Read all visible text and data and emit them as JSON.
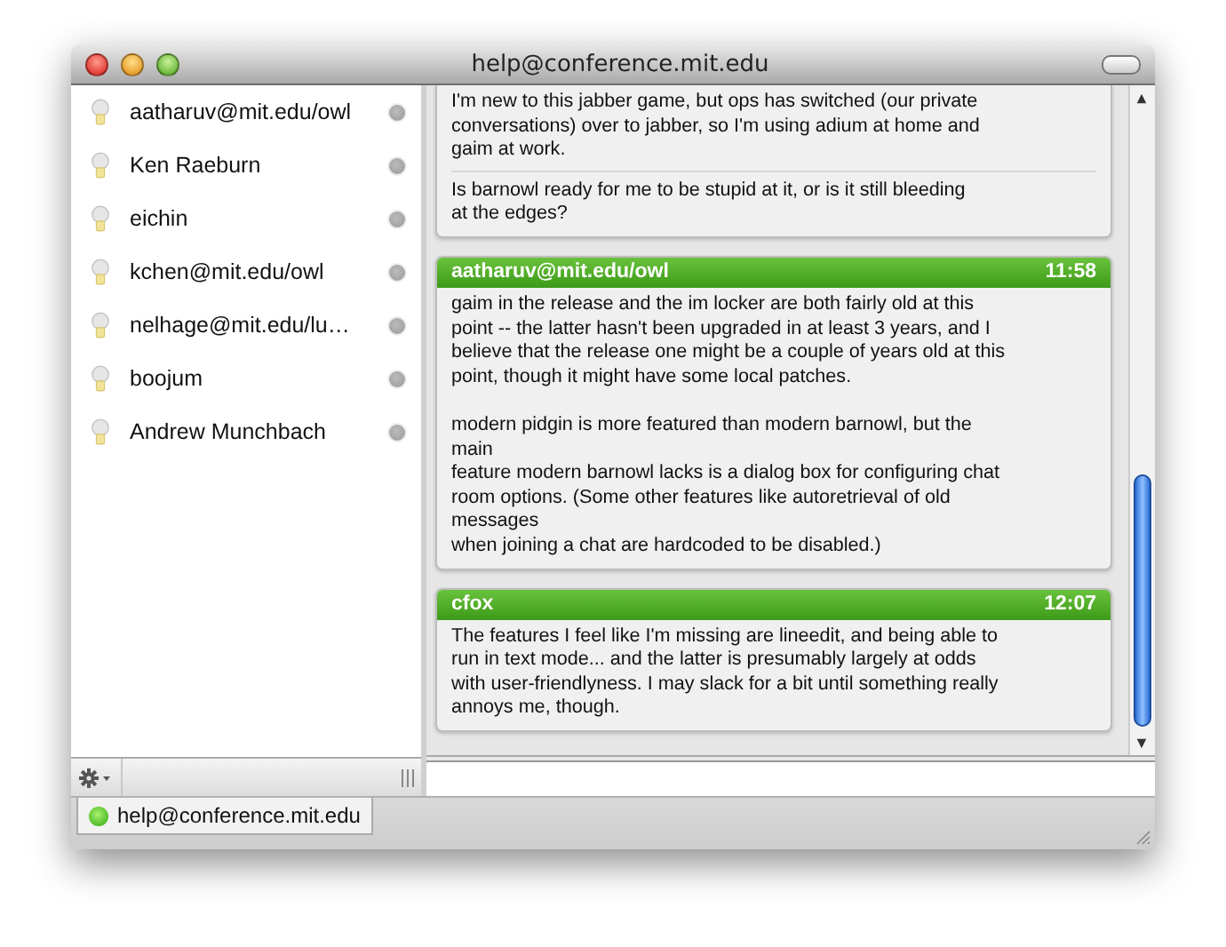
{
  "window": {
    "title": "help@conference.mit.edu"
  },
  "contacts": [
    {
      "name": "aatharuv@mit.edu/owl"
    },
    {
      "name": "Ken Raeburn"
    },
    {
      "name": "eichin"
    },
    {
      "name": "kchen@mit.edu/owl"
    },
    {
      "name": "nelhage@mit.edu/lu…"
    },
    {
      "name": "boojum"
    },
    {
      "name": "Andrew Munchbach"
    }
  ],
  "messages": [
    {
      "paragraphs": [
        "I'm new to this jabber game, but ops has switched (our private\nconversations) over to jabber, so I'm using adium at home and\ngaim at work.",
        "Is barnowl ready for me to be stupid at it, or is it still bleeding\nat the edges?"
      ]
    },
    {
      "sender": "aatharuv@mit.edu/owl",
      "time": "11:58",
      "paragraphs": [
        "gaim in the release and the im locker are both fairly old at this\npoint -- the latter hasn't been upgraded in at least 3 years, and I\nbelieve that the release one might be a couple of years old at this\npoint, though it might have some local patches.\n\nmodern pidgin is more featured than modern barnowl, but the\nmain\nfeature modern barnowl lacks is a dialog box for configuring chat\nroom options. (Some other features like autoretrieval of old\nmessages\nwhen joining a chat are hardcoded to be disabled.)"
      ]
    },
    {
      "sender": "cfox",
      "time": "12:07",
      "paragraphs": [
        "The features I feel like I'm missing are lineedit, and being able to\nrun in text mode... and the latter is presumably largely at odds\nwith user-friendlyness.  I may slack for a bit until something really\nannoys me, though."
      ]
    }
  ],
  "tabs": [
    {
      "label": "help@conference.mit.edu",
      "selected": true
    }
  ]
}
